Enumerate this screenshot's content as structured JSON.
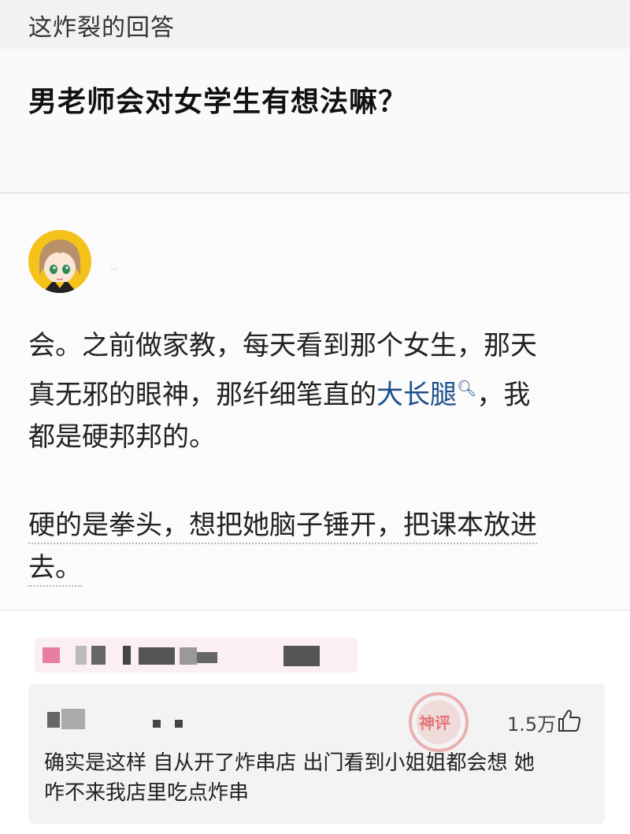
{
  "caption": "这炸裂的回答",
  "question": {
    "title": "男老师会对女学生有想法嘛？"
  },
  "answer": {
    "author_placeholder": "..",
    "p1_a": "会。之前做家教，每天看到那个女生，那天",
    "p1_b": "真无邪的眼神，那纤细笔直的",
    "p1_link": "大长腿",
    "p1_c": "，我",
    "p1_d": "都是硬邦邦的。",
    "p2_a": "硬的是拳头，想把她脑子锤开，把课本放进",
    "p2_b": "去。"
  },
  "comment": {
    "likes": "1.5万",
    "text_line1": "确实是这样 自从开了炸串店 出门看到小姐姐都会想 她",
    "text_line2": "咋不来我店里吃点炸串",
    "stamp_text": "神评"
  },
  "colors": {
    "link": "#1d4f8c",
    "avatar_bg": "#f4c21a",
    "stamp": "#dd3333"
  },
  "icons": {
    "thumb": "thumbs-up-icon",
    "search": "search-icon",
    "avatar": "anime-avatar"
  }
}
